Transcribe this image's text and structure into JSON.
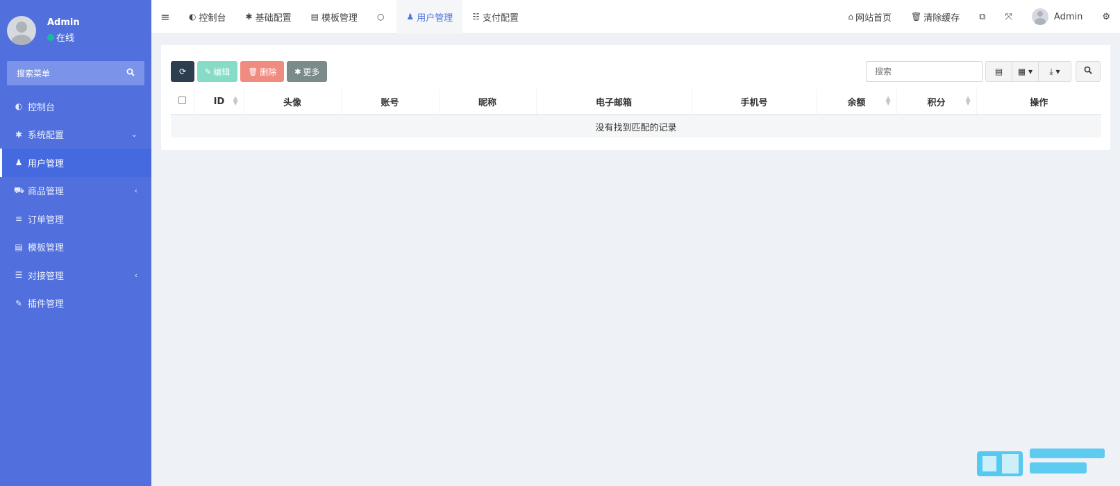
{
  "sidebar": {
    "user_name": "Admin",
    "status": "在线",
    "search_label": "搜索菜单",
    "items": [
      {
        "icon": "dashboard-icon",
        "glyph": "⚙",
        "label": "控制台"
      },
      {
        "icon": "gear-icon",
        "glyph": "✿",
        "label": "系统配置",
        "arrow": "⌄"
      },
      {
        "icon": "user-icon",
        "glyph": "♟",
        "label": "用户管理"
      },
      {
        "icon": "cart-icon",
        "glyph": "⛟",
        "label": "商品管理",
        "arrow": "‹"
      },
      {
        "icon": "list-icon",
        "glyph": "≡",
        "label": "订单管理"
      },
      {
        "icon": "template-icon",
        "glyph": "▤",
        "label": "模板管理"
      },
      {
        "icon": "sliders-icon",
        "glyph": "⚌",
        "label": "对接管理",
        "arrow": "‹"
      },
      {
        "icon": "plug-icon",
        "glyph": "✎",
        "label": "插件管理"
      }
    ]
  },
  "topnav": {
    "tabs": [
      {
        "icon": "dashboard-icon",
        "label": "控制台"
      },
      {
        "icon": "gear-icon",
        "label": "基础配置"
      },
      {
        "icon": "template-icon",
        "label": "模板管理"
      },
      {
        "icon": "circle-icon",
        "label": ""
      },
      {
        "icon": "user-icon",
        "label": "用户管理"
      },
      {
        "icon": "server-icon",
        "label": "支付配置"
      }
    ],
    "home_label": "网站首页",
    "clear_cache_label": "清除缓存",
    "user_name": "Admin"
  },
  "toolbar": {
    "edit_label": "编辑",
    "delete_label": "删除",
    "more_label": "更多",
    "search_placeholder": "搜索"
  },
  "table": {
    "columns": [
      "ID",
      "头像",
      "账号",
      "昵称",
      "电子邮箱",
      "手机号",
      "余额",
      "积分",
      "操作"
    ],
    "empty_text": "没有找到匹配的记录"
  },
  "colors": {
    "sidebar_bg": "#5170dd",
    "accent": "#4c73e0",
    "online": "#18bc9c",
    "delete": "#f08b80",
    "edit": "#86dcc6"
  }
}
